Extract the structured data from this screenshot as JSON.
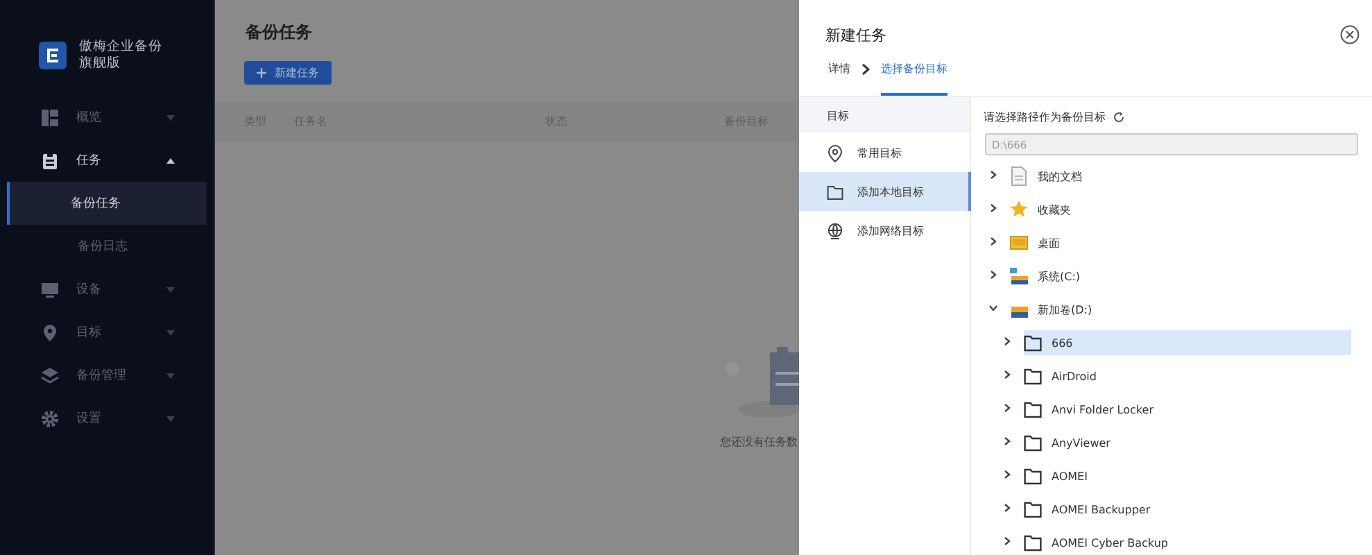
{
  "sidebar": {
    "brand": {
      "name": "傲梅企业备份",
      "edition": "旗舰版"
    },
    "items": [
      {
        "label": "概览",
        "expanded": false
      },
      {
        "label": "任务",
        "expanded": true,
        "children": [
          {
            "label": "备份任务",
            "selected": true
          },
          {
            "label": "备份日志",
            "selected": false
          }
        ]
      },
      {
        "label": "设备",
        "expanded": false
      },
      {
        "label": "目标",
        "expanded": false
      },
      {
        "label": "备份管理",
        "expanded": false
      },
      {
        "label": "设置",
        "expanded": false
      }
    ]
  },
  "main": {
    "title": "备份任务",
    "new_button": "新建任务",
    "table": {
      "columns": [
        "类型",
        "任务名",
        "状态",
        "备份目标"
      ]
    },
    "empty_text": "您还没有任务数"
  },
  "drawer": {
    "title": "新建任务",
    "steps": [
      {
        "label": "详情",
        "selected": false
      },
      {
        "label": "选择备份目标",
        "selected": true
      }
    ],
    "nav": {
      "header": "目标",
      "items": [
        {
          "label": "常用目标",
          "selected": false
        },
        {
          "label": "添加本地目标",
          "selected": true
        },
        {
          "label": "添加网络目标",
          "selected": false
        }
      ]
    },
    "path_label": "请选择路径作为备份目标",
    "path_value": "D:\\666",
    "tree": [
      {
        "label": "我的文档",
        "kind": "document",
        "expanded": false,
        "selected": false
      },
      {
        "label": "收藏夹",
        "kind": "favorites",
        "expanded": false,
        "selected": false
      },
      {
        "label": "桌面",
        "kind": "desktop",
        "expanded": false,
        "selected": false
      },
      {
        "label": "系统(C:)",
        "kind": "system-drive",
        "expanded": false,
        "selected": false
      },
      {
        "label": "新加卷(D:)",
        "kind": "drive",
        "expanded": true,
        "selected": false,
        "children": [
          {
            "label": "666",
            "kind": "folder",
            "expanded": false,
            "selected": true
          },
          {
            "label": "AirDroid",
            "kind": "folder",
            "expanded": false,
            "selected": false
          },
          {
            "label": "Anvi Folder Locker",
            "kind": "folder",
            "expanded": false,
            "selected": false
          },
          {
            "label": "AnyViewer",
            "kind": "folder",
            "expanded": false,
            "selected": false
          },
          {
            "label": "AOMEI",
            "kind": "folder",
            "expanded": false,
            "selected": false
          },
          {
            "label": "AOMEI Backupper",
            "kind": "folder",
            "expanded": false,
            "selected": false
          },
          {
            "label": "AOMEI Cyber Backup",
            "kind": "folder",
            "expanded": false,
            "selected": false
          }
        ]
      }
    ]
  }
}
